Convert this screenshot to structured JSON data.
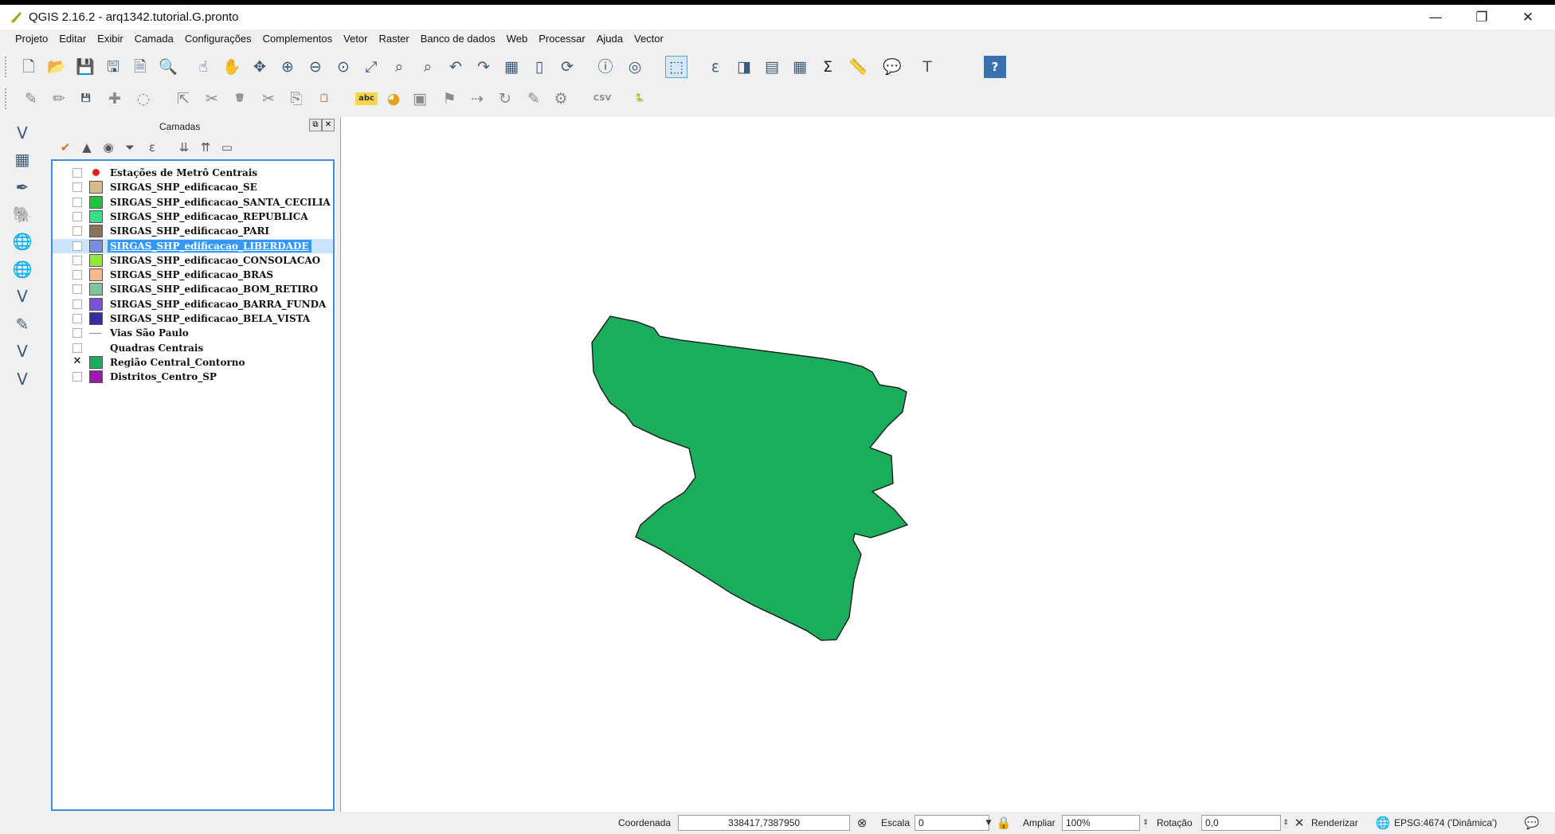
{
  "window": {
    "title": "QGIS 2.16.2 - arq1342.tutorial.G.pronto",
    "controls": {
      "minimize": "—",
      "restore": "❐",
      "close": "✕"
    }
  },
  "menu": [
    "Projeto",
    "Editar",
    "Exibir",
    "Camada",
    "Configurações",
    "Complementos",
    "Vetor",
    "Raster",
    "Banco de dados",
    "Web",
    "Processar",
    "Ajuda",
    "Vector"
  ],
  "toolbar1": [
    {
      "icon": "new-project-icon",
      "glyph": "🗋"
    },
    {
      "icon": "open-project-icon",
      "glyph": "📂"
    },
    {
      "icon": "save-project-icon",
      "glyph": "💾"
    },
    {
      "icon": "save-as-icon",
      "glyph": "🖫"
    },
    {
      "icon": "new-print-composer-icon",
      "glyph": "🗎"
    },
    {
      "icon": "composer-manager-icon",
      "glyph": "🔍"
    },
    {
      "icon": "touch-zoom-icon",
      "glyph": "☝"
    },
    {
      "icon": "pan-icon",
      "glyph": "✋"
    },
    {
      "icon": "pan-to-selection-icon",
      "glyph": "✥"
    },
    {
      "icon": "zoom-in-icon",
      "glyph": "⊕"
    },
    {
      "icon": "zoom-out-icon",
      "glyph": "⊖"
    },
    {
      "icon": "zoom-native-icon",
      "glyph": "⊙"
    },
    {
      "icon": "zoom-full-icon",
      "glyph": "⤢"
    },
    {
      "icon": "zoom-to-selection-icon",
      "glyph": "⌕"
    },
    {
      "icon": "zoom-to-layer-icon",
      "glyph": "⌕"
    },
    {
      "icon": "zoom-last-icon",
      "glyph": "↶"
    },
    {
      "icon": "zoom-next-icon",
      "glyph": "↷"
    },
    {
      "icon": "new-map-view-icon",
      "glyph": "▦"
    },
    {
      "icon": "new-bookmark-icon",
      "glyph": "▯"
    },
    {
      "icon": "refresh-icon",
      "glyph": "⟳"
    },
    {
      "icon": "identify-icon",
      "glyph": "ⓘ"
    },
    {
      "icon": "map-tips-icon",
      "glyph": "◎"
    },
    {
      "icon": "select-features-icon",
      "glyph": "⬚"
    },
    {
      "icon": "select-by-expression-icon",
      "glyph": "ε"
    },
    {
      "icon": "deselect-icon",
      "glyph": "◨"
    },
    {
      "icon": "attribute-table-icon",
      "glyph": "▤"
    },
    {
      "icon": "field-calculator-icon",
      "glyph": "▦"
    },
    {
      "icon": "statistics-icon",
      "glyph": "Σ"
    },
    {
      "icon": "measure-icon",
      "glyph": "📏"
    },
    {
      "icon": "annotation-icon",
      "glyph": "💬"
    },
    {
      "icon": "text-annotation-icon",
      "glyph": "T"
    },
    {
      "icon": "help-icon",
      "glyph": "?"
    }
  ],
  "toolbar2": [
    {
      "icon": "current-edits-icon",
      "glyph": "✎"
    },
    {
      "icon": "toggle-editing-icon",
      "glyph": "✏"
    },
    {
      "icon": "save-edits-icon",
      "glyph": "💾"
    },
    {
      "icon": "add-feature-icon",
      "glyph": "✚"
    },
    {
      "icon": "add-part-icon",
      "glyph": "◌"
    },
    {
      "icon": "move-feature-icon",
      "glyph": "⇱"
    },
    {
      "icon": "node-tool-icon",
      "glyph": "✂"
    },
    {
      "icon": "delete-selected-icon",
      "glyph": "🗑"
    },
    {
      "icon": "cut-features-icon",
      "glyph": "✂"
    },
    {
      "icon": "copy-features-icon",
      "glyph": "⎘"
    },
    {
      "icon": "paste-features-icon",
      "glyph": "📋"
    },
    {
      "icon": "label-icon",
      "glyph": "abc"
    },
    {
      "icon": "diagram-icon",
      "glyph": "◕"
    },
    {
      "icon": "pin-labels-icon",
      "glyph": "▣"
    },
    {
      "icon": "show-hide-labels-icon",
      "glyph": "⚑"
    },
    {
      "icon": "move-label-icon",
      "glyph": "⇢"
    },
    {
      "icon": "rotate-label-icon",
      "glyph": "↻"
    },
    {
      "icon": "change-label-icon",
      "glyph": "✎"
    },
    {
      "icon": "label-properties-icon",
      "glyph": "⚙"
    },
    {
      "icon": "add-csv-layer-icon",
      "glyph": "CSV"
    },
    {
      "icon": "python-console-icon",
      "glyph": "🐍"
    }
  ],
  "left_toolbar": [
    {
      "icon": "add-vector-layer-icon",
      "glyph": "V"
    },
    {
      "icon": "add-raster-layer-icon",
      "glyph": "▦"
    },
    {
      "icon": "add-spatialite-layer-icon",
      "glyph": "✒"
    },
    {
      "icon": "add-postgis-layer-icon",
      "glyph": "🐘"
    },
    {
      "icon": "add-wms-layer-icon",
      "glyph": "🌐"
    },
    {
      "icon": "add-wcs-layer-icon",
      "glyph": "🌐"
    },
    {
      "icon": "add-wfs-layer-icon",
      "glyph": "V"
    },
    {
      "icon": "add-delimited-text-icon",
      "glyph": "✎"
    },
    {
      "icon": "add-virtual-layer-icon",
      "glyph": "V"
    },
    {
      "icon": "new-shapefile-icon",
      "glyph": "V"
    }
  ],
  "layers_panel": {
    "title": "Camadas",
    "float_btn": "⧉",
    "close_btn": "✕",
    "tools": [
      {
        "icon": "style-manager-icon",
        "glyph": "✔"
      },
      {
        "icon": "add-group-icon",
        "glyph": "▲"
      },
      {
        "icon": "manage-visibility-icon",
        "glyph": "◉"
      },
      {
        "icon": "filter-legend-icon",
        "glyph": "⏷"
      },
      {
        "icon": "filter-expression-icon",
        "glyph": "ε"
      },
      {
        "icon": "expand-all-icon",
        "glyph": "⇊"
      },
      {
        "icon": "collapse-all-icon",
        "glyph": "⇈"
      },
      {
        "icon": "remove-layer-icon",
        "glyph": "▭"
      }
    ],
    "layers": [
      {
        "name": "Estações de Metrô Centrais",
        "color": "#e02020",
        "symbol": "point",
        "checked": false
      },
      {
        "name": "SIRGAS_SHP_edificacao_SE",
        "color": "#d7b98a",
        "symbol": "fill",
        "checked": false
      },
      {
        "name": "SIRGAS_SHP_edificacao_SANTA_CECILIA",
        "color": "#22c33c",
        "symbol": "fill",
        "checked": false
      },
      {
        "name": "SIRGAS_SHP_edificacao_REPUBLICA",
        "color": "#35e08a",
        "symbol": "fill",
        "checked": false
      },
      {
        "name": "SIRGAS_SHP_edificacao_PARI",
        "color": "#8a7358",
        "symbol": "fill",
        "checked": false
      },
      {
        "name": "SIRGAS_SHP_edificacao_LIBERDADE",
        "color": "#7a8ee0",
        "symbol": "fill",
        "checked": false,
        "selected": true
      },
      {
        "name": "SIRGAS_SHP_edificacao_CONSOLACAO",
        "color": "#93e83a",
        "symbol": "fill",
        "checked": false
      },
      {
        "name": "SIRGAS_SHP_edificacao_BRAS",
        "color": "#f6b98a",
        "symbol": "fill",
        "checked": false
      },
      {
        "name": "SIRGAS_SHP_edificacao_BOM_RETIRO",
        "color": "#7fc4a0",
        "symbol": "fill",
        "checked": false
      },
      {
        "name": "SIRGAS_SHP_edificacao_BARRA_FUNDA",
        "color": "#7a52d8",
        "symbol": "fill",
        "checked": false
      },
      {
        "name": "SIRGAS_SHP_edificacao_BELA_VISTA",
        "color": "#3a2aa8",
        "symbol": "fill",
        "checked": false
      },
      {
        "name": "Vias São Paulo",
        "color": "#888888",
        "symbol": "line",
        "checked": false
      },
      {
        "name": "Quadras Centrais",
        "color": "#ffffff",
        "symbol": "fill-empty",
        "checked": false
      },
      {
        "name": "Região Central_Contorno",
        "color": "#1aad5c",
        "symbol": "fill",
        "checked": true
      },
      {
        "name": "Distritos_Centro_SP",
        "color": "#9b1ab0",
        "symbol": "fill",
        "checked": false
      }
    ]
  },
  "map": {
    "polygon_fill": "#1aad5c",
    "polygon_stroke": "#111111"
  },
  "statusbar": {
    "coord_label": "Coordenada",
    "coord_value": "338417,7387950",
    "scale_label": "Escala",
    "scale_value": "0",
    "magnifier_label": "Ampliar",
    "magnifier_value": "100%",
    "rotation_label": "Rotação",
    "rotation_value": "0,0",
    "render_label": "Renderizar",
    "render_checked": "✕",
    "crs": "EPSG:4674 ('Dinâmica')",
    "messages_icon": "💬"
  }
}
